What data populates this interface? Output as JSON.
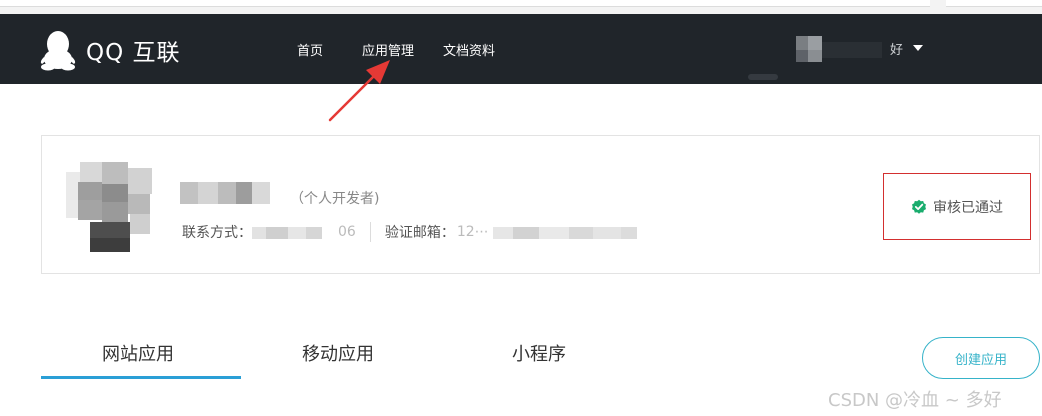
{
  "header": {
    "logo_text": "QQ 互联",
    "nav": {
      "home": "首页",
      "apps": "应用管理",
      "docs": "文档资料"
    },
    "user_name_visible": "好"
  },
  "developer": {
    "type": "（个人开发者)",
    "contact_label": "联系方式：",
    "contact_visible": "06",
    "email_label": "验证邮箱：",
    "email_visible": "12⋯"
  },
  "status": {
    "text": "审核已通过",
    "color": "#1aad6e"
  },
  "tabs": [
    {
      "label": "网站应用",
      "active": true
    },
    {
      "label": "移动应用",
      "active": false
    },
    {
      "label": "小程序",
      "active": false
    }
  ],
  "create_button": "创建应用",
  "watermark": "CSDN @冷血 ~ 多好",
  "colors": {
    "header_bg": "#20252a",
    "accent": "#2a9fd6",
    "button": "#36b3c9",
    "annotation": "#e53935"
  }
}
